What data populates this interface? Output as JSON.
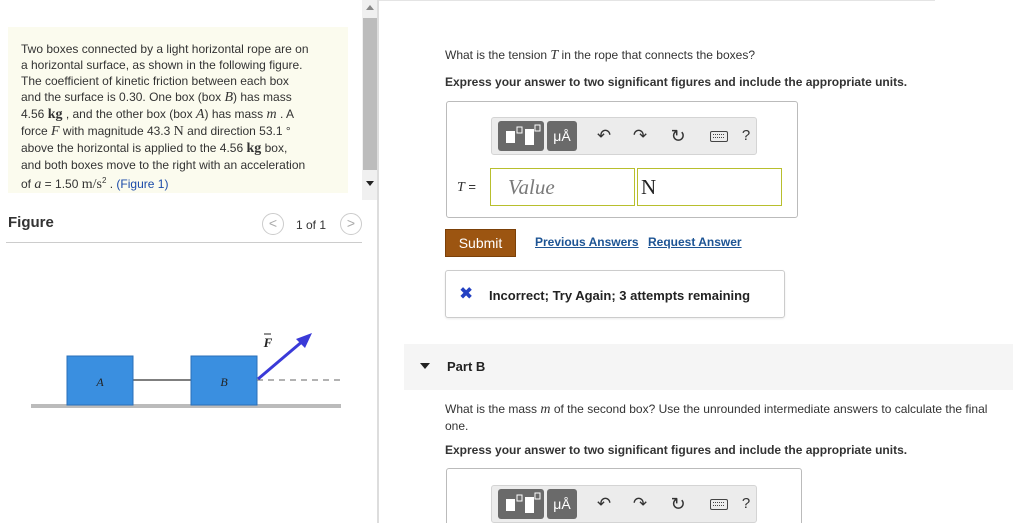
{
  "problem": {
    "line1": "Two boxes connected by a light horizontal rope are on",
    "line2": "a horizontal surface, as shown in the following figure.",
    "line3": "The coefficient of kinetic friction between each box",
    "line4a": "and the surface is 0.30. One box (box ",
    "line4_B": "B",
    "line4b": ") has mass",
    "line5a": "4.56 ",
    "line5_kg": "kg",
    "line5b": " , and the other box (box ",
    "line5_A": "A",
    "line5c": ") has mass ",
    "line5_m": "m",
    "line5d": " . A",
    "line6a": "force ",
    "line6_F": "F",
    "line6b": " with magnitude 43.3 ",
    "line6_N": "N",
    "line6c": " and direction 53.1 °",
    "line7a": "above the horizontal is applied to the 4.56 ",
    "line7_kg": "kg",
    "line7b": " box,",
    "line8": "and both boxes move to the right with an acceleration",
    "line9a": "of ",
    "line9_a": "a",
    "line9b": " = 1.50 ",
    "line9_units": "m/s",
    "line9_exp": "2",
    "line9c": " . ",
    "figure_link": "(Figure 1)"
  },
  "figure": {
    "title": "Figure",
    "prev": "<",
    "next": ">",
    "page_count": "1 of 1",
    "box_a": "A",
    "box_b": "B",
    "force_label": "F",
    "colors": {
      "box": "#3a8fe0",
      "arrow": "#3a3ad8",
      "surface": "#bbbbbb"
    }
  },
  "part_a": {
    "question_pre": "What is the tension ",
    "question_var": "T",
    "question_post": " in the rope that connects the boxes?",
    "instruction": "Express your answer to two significant figures and include the appropriate units.",
    "toolbar": {
      "units": "μÅ",
      "undo": "↶",
      "redo": "↷",
      "reset": "↻",
      "help": "?"
    },
    "label_var": "T",
    "label_eq": " =",
    "value_placeholder": "Value",
    "unit_value": "N",
    "submit": "Submit",
    "previous_answers": "Previous Answers",
    "request_answer": "Request Answer",
    "feedback_icon": "✖",
    "feedback": "Incorrect; Try Again; 3 attempts remaining"
  },
  "part_b": {
    "title": "Part B",
    "question_pre": "What is the mass ",
    "question_var": "m",
    "question_post": " of the second box? Use the unrounded intermediate answers to calculate the final one.",
    "instruction": "Express your answer to two significant figures and include the appropriate units.",
    "toolbar": {
      "units": "μÅ",
      "undo": "↶",
      "redo": "↷",
      "reset": "↻",
      "help": "?"
    }
  }
}
